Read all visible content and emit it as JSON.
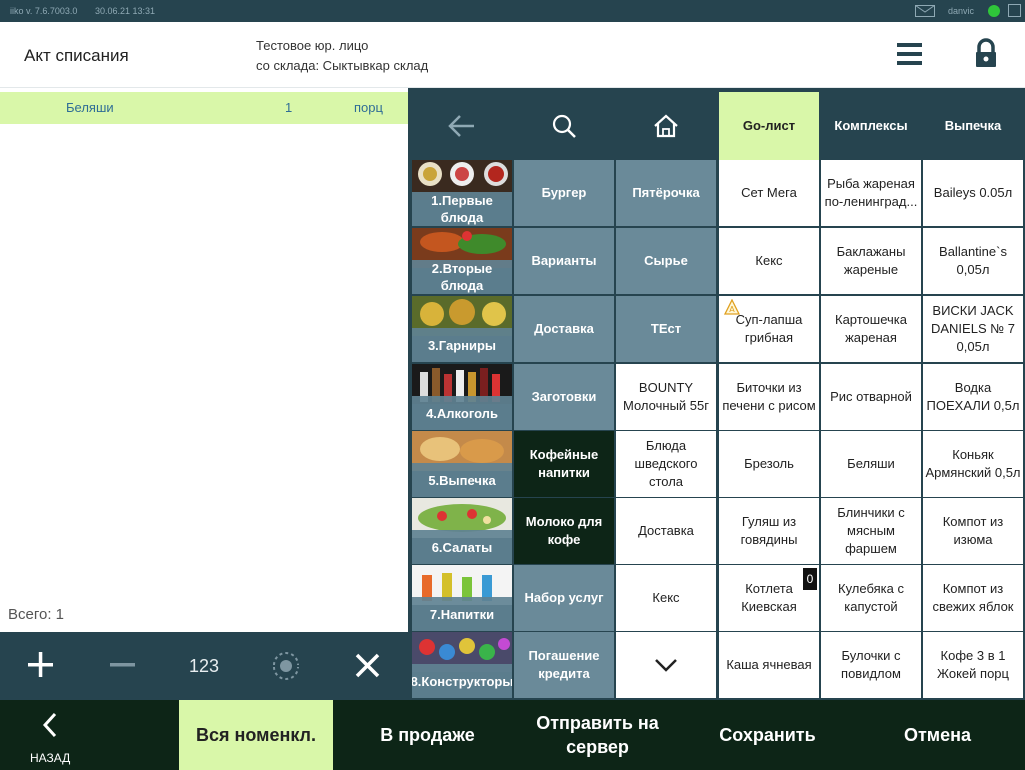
{
  "status_bar": {
    "app_version": "iiko  v. 7.6.7003.0",
    "datetime": "30.06.21  13:31",
    "user": "danvic"
  },
  "header": {
    "title": "Акт списания",
    "legal_entity": "Тестовое юр. лицо",
    "warehouse": "со склада: Сыктывкар склад"
  },
  "order": {
    "rows": [
      {
        "name": "Беляши",
        "qty": "1",
        "unit": "порц"
      }
    ],
    "total": "Всего: 1"
  },
  "left_toolbar": {
    "qty_label": "123"
  },
  "top_tabs": [
    "Go-лист",
    "Комплексы",
    "Выпечка"
  ],
  "image_categories": [
    "1.Первые блюда",
    "2.Вторые блюда",
    "3.Гарниры",
    "4.Алкоголь",
    "5.Выпечка",
    "6.Салаты",
    "7.Напитки",
    "8.Конструкторы"
  ],
  "col2": [
    "Бургер",
    "Варианты",
    "Доставка",
    "Заготовки",
    "Кофейные напитки",
    "Молоко для кофе",
    "Набор услуг",
    "Погашение кредита"
  ],
  "col3": [
    "Пятёрочка",
    "Сырье",
    "ТЕст",
    "BOUNTY Молочный 55г",
    "Блюда шведского стола",
    "Доставка",
    "Кекс"
  ],
  "col4": [
    "Сет Мега",
    "Кекс",
    "Суп-лапша грибная",
    "Биточки из печени с рисом",
    "Брезоль",
    "Гуляш из говядины",
    "Котлета Киевская",
    "Каша ячневая"
  ],
  "col5": [
    "Рыба жареная по-ленинград...",
    "Баклажаны жареные",
    "Картошечка жареная",
    "Рис отварной",
    "Беляши",
    "Блинчики с мясным фаршем",
    "Кулебяка с капустой",
    "Булочки с повидлом"
  ],
  "col6": [
    "Baileys 0.05л",
    "Ballantine`s 0,05л",
    "ВИСКИ JACK DANIELS № 7 0,05л",
    "Водка ПОЕХАЛИ 0,5л",
    "Коньяк Армянский 0,5л",
    "Компот из изюма",
    "Компот из свежих яблок",
    "Кофе 3 в 1 Жокей порц"
  ],
  "badge": "0",
  "bottom": {
    "back": "НАЗАД",
    "all": "Вся номенкл.",
    "on_sale": "В продаже",
    "send": "Отправить на сервер",
    "save": "Сохранить",
    "cancel": "Отмена"
  },
  "colors": {
    "dark_bg": "#26444f",
    "accent_green": "#d9f7a9",
    "category_blue": "#6a8a99",
    "dark_green": "#0d2517"
  }
}
